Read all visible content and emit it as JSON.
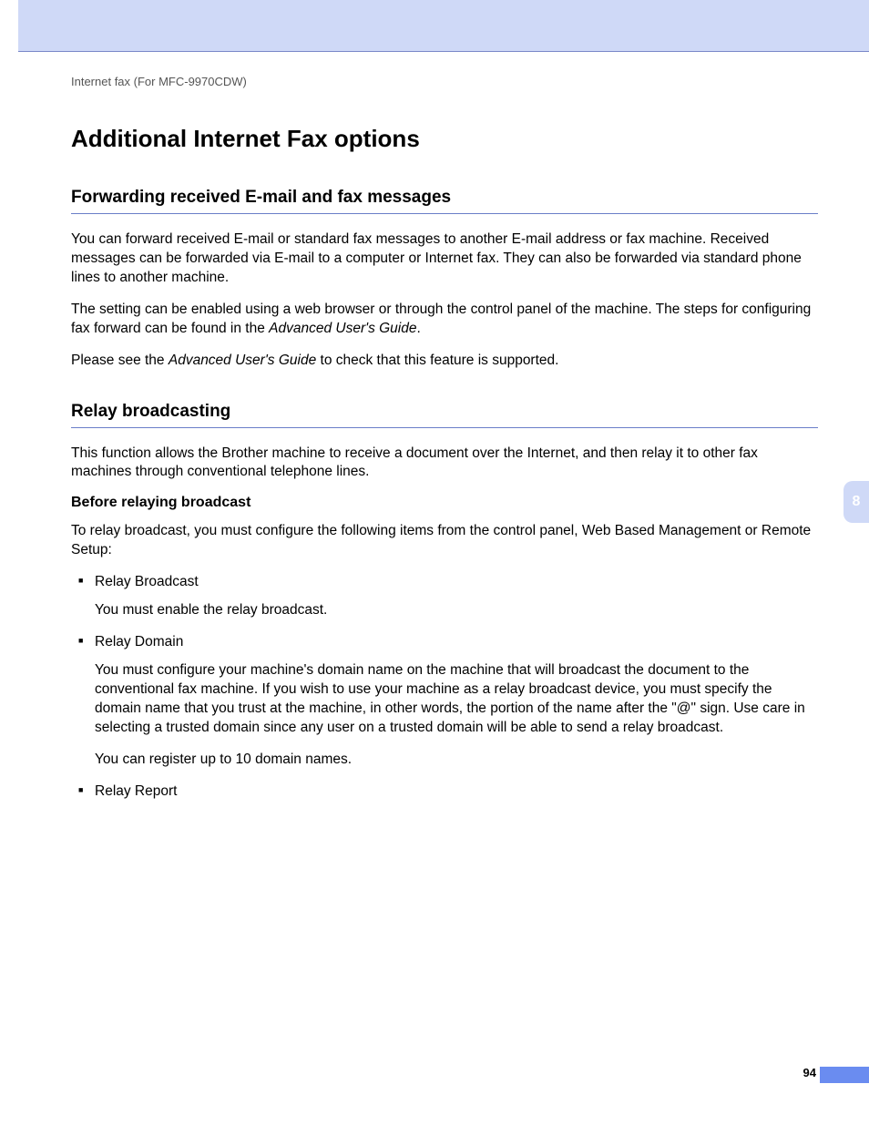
{
  "header": {
    "path": "Internet fax (For MFC-9970CDW)"
  },
  "title": "Additional Internet Fax options",
  "section1": {
    "heading": "Forwarding received E-mail and fax messages",
    "p1": "You can forward received E-mail or standard fax messages to another E-mail address or fax machine. Received messages can be forwarded via E-mail to a computer or Internet fax. They can also be forwarded via standard phone lines to another machine.",
    "p2a": "The setting can be enabled using a web browser or through the control panel of the machine. The steps for configuring fax forward can be found in the ",
    "p2b": "Advanced User's Guide",
    "p2c": ".",
    "p3a": "Please see the ",
    "p3b": "Advanced User's Guide",
    "p3c": " to check that this feature is supported."
  },
  "section2": {
    "heading": "Relay broadcasting",
    "p1": "This function allows the Brother machine to receive a document over the Internet, and then relay it to other fax machines through conventional telephone lines.",
    "sub": "Before relaying broadcast",
    "p2": "To relay broadcast, you must configure the following items from the control panel, Web Based Management or Remote Setup:",
    "items": [
      {
        "head": "Relay Broadcast",
        "body": "You must enable the relay broadcast."
      },
      {
        "head": "Relay Domain",
        "body": "You must configure your machine's domain name on the machine that will broadcast the document to the conventional fax machine. If you wish to use your machine as a relay broadcast device, you must specify the domain name that you trust at the machine, in other words, the portion of the name after the \"@\" sign. Use care in selecting a trusted domain since any user on a trusted domain will be able to send a relay broadcast.",
        "body2": "You can register up to 10 domain names."
      },
      {
        "head": "Relay Report"
      }
    ]
  },
  "chapter": "8",
  "pageNumber": "94"
}
